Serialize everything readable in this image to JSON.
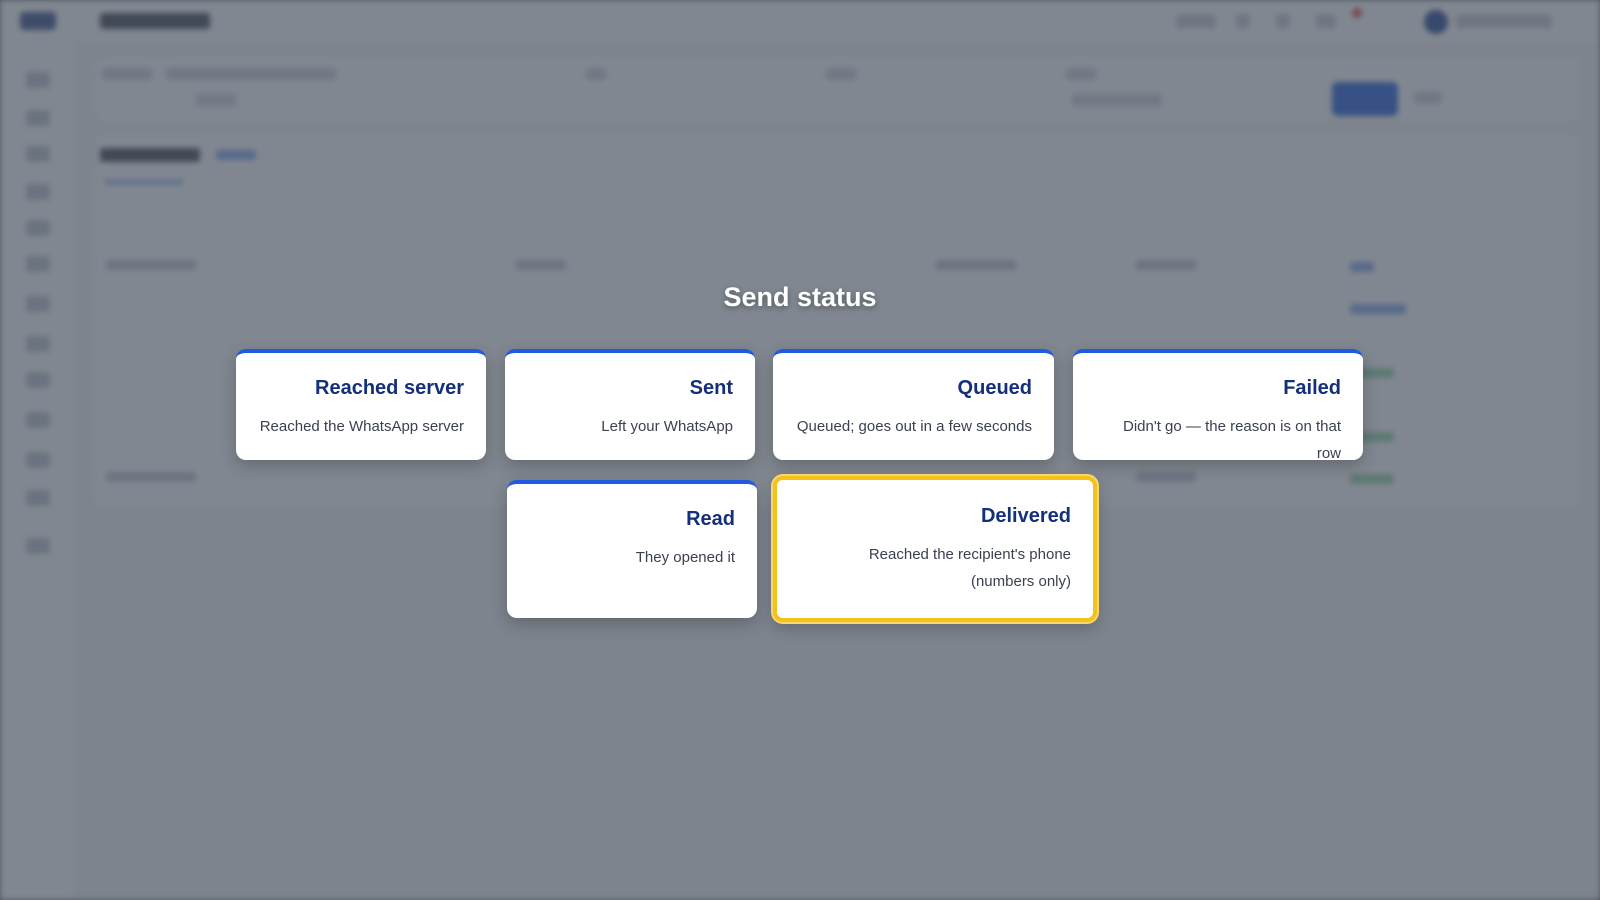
{
  "overlay": {
    "title": "Send status",
    "cards": [
      {
        "title": "Reached server",
        "description": "Reached the WhatsApp server",
        "highlighted": false
      },
      {
        "title": "Sent",
        "description": "Left your WhatsApp",
        "highlighted": false
      },
      {
        "title": "Queued",
        "description": "Queued; goes out in a few seconds",
        "highlighted": false
      },
      {
        "title": "Failed",
        "description": "Didn't go — the reason is on that row",
        "highlighted": false
      },
      {
        "title": "Read",
        "description": "They opened it",
        "highlighted": false
      },
      {
        "title": "Delivered",
        "description": "Reached the recipient's phone (numbers only)",
        "highlighted": true
      }
    ]
  },
  "colors": {
    "card_accent": "#1f5ae0",
    "card_title": "#15307a",
    "highlight": "#f4c21d",
    "primary_button": "#1a56db"
  }
}
